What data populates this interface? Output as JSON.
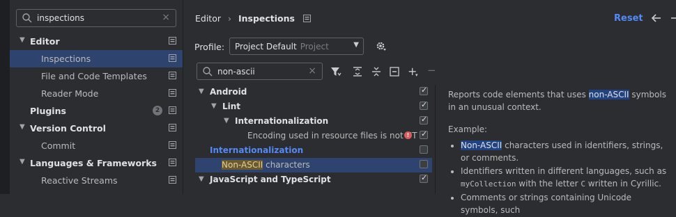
{
  "left_search": {
    "value": "inspections"
  },
  "nav": [
    {
      "label": "Editor",
      "level": 0,
      "expanded": true,
      "bold": true,
      "page_icon": true
    },
    {
      "label": "Inspections",
      "level": 1,
      "selected": true,
      "page_icon": true
    },
    {
      "label": "File and Code Templates",
      "level": 1,
      "page_icon": true
    },
    {
      "label": "Reader Mode",
      "level": 1,
      "page_icon": true
    },
    {
      "label": "Plugins",
      "level": 0,
      "bold": true,
      "badge": "2",
      "page_icon": true
    },
    {
      "label": "Version Control",
      "level": 0,
      "expanded": true,
      "bold": true,
      "page_icon": true
    },
    {
      "label": "Commit",
      "level": 1,
      "page_icon": true
    },
    {
      "label": "Languages & Frameworks",
      "level": 0,
      "expanded": true,
      "bold": true,
      "page_icon": true
    },
    {
      "label": "Reactive Streams",
      "level": 1,
      "page_icon": true
    }
  ],
  "breadcrumb": {
    "parent": "Editor",
    "separator": "›",
    "current": "Inspections"
  },
  "header": {
    "reset_label": "Reset"
  },
  "profile": {
    "label": "Profile:",
    "value": "Project Default",
    "scope": "Project"
  },
  "inspection_search": {
    "value": "non-ascii"
  },
  "inspections": [
    {
      "label": "Android",
      "style": "bold",
      "arrow": true,
      "checked": true
    },
    {
      "label": "Lint",
      "style": "bold",
      "arrow": true,
      "checked": true
    },
    {
      "label": "Internationalization",
      "style": "bold",
      "arrow": true,
      "checked": true
    },
    {
      "label": "Encoding used in resource files is not UT",
      "style": "normal",
      "checked": true,
      "warning": true
    },
    {
      "label": "Internationalization",
      "style": "blue",
      "checked": false
    },
    {
      "label_highlight": "Non-ASCII",
      "label_rest": " characters",
      "style": "normal",
      "checked": false,
      "selected": true
    },
    {
      "label": "JavaScript and TypeScript",
      "style": "bold",
      "arrow": true,
      "checked": true
    }
  ],
  "description": {
    "intro_before": "Reports code elements that uses ",
    "intro_highlight": "non-ASCII",
    "intro_after": " symbols in an unusual context.",
    "example_heading": "Example:",
    "bullet1_highlight": "Non-ASCII",
    "bullet1_rest": " characters used in identifiers, strings, or comments.",
    "bullet2_before": "Identifiers written in different languages, such as ",
    "bullet2_code1": "myCollection",
    "bullet2_mid": " with the letter ",
    "bullet2_code2": "C",
    "bullet2_after": " written in Cyrillic.",
    "bullet3": "Comments or strings containing Unicode symbols, such"
  },
  "colors": {
    "accent": "#548af7",
    "selection": "#2e436e",
    "background": "#2b2d30",
    "match_highlight": "#214283"
  }
}
